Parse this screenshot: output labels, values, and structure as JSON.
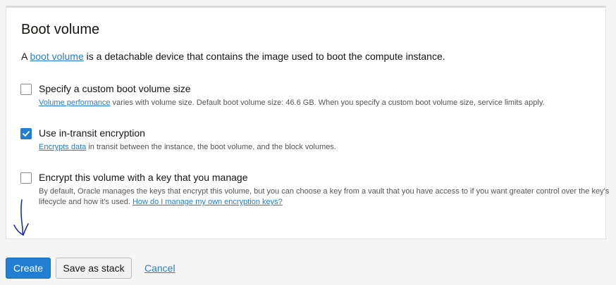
{
  "section": {
    "title": "Boot volume",
    "desc_prefix": "A ",
    "desc_link": "boot volume",
    "desc_suffix": " is a detachable device that contains the image used to boot the compute instance."
  },
  "options": [
    {
      "label": "Specify a custom boot volume size",
      "checked": false,
      "help_link": "Volume performance",
      "help_text": " varies with volume size. Default boot volume size: 46.6 GB. When you specify a custom boot volume size, service limits apply."
    },
    {
      "label": "Use in-transit encryption",
      "checked": true,
      "help_link": "Encrypts data",
      "help_text": " in transit between the instance, the boot volume, and the block volumes."
    },
    {
      "label": "Encrypt this volume with a key that you manage",
      "checked": false,
      "help_text": "By default, Oracle manages the keys that encrypt this volume, but you can choose a key from a vault that you have access to if you want greater control over the key's lifecycle and how it's used. ",
      "help_link": "How do I manage my own encryption keys?"
    }
  ],
  "footer": {
    "create_label": "Create",
    "save_stack_label": "Save as stack",
    "cancel_label": "Cancel"
  },
  "colors": {
    "accent": "#227ed1",
    "annotation": "#1f2fb0"
  }
}
